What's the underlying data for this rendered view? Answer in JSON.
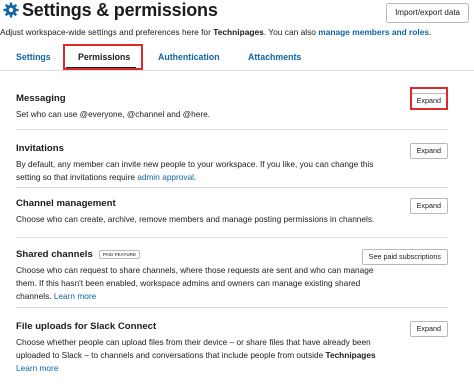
{
  "header": {
    "title": "Settings & permissions",
    "import_export_label": "Import/export data"
  },
  "subtitle": {
    "text_before": "Adjust workspace-wide settings and preferences here for ",
    "workspace": "Technipages",
    "text_middle": ". You can also ",
    "link": "manage members and roles",
    "text_after": "."
  },
  "tabs": [
    {
      "label": "Settings"
    },
    {
      "label": "Permissions"
    },
    {
      "label": "Authentication"
    },
    {
      "label": "Attachments"
    }
  ],
  "active_tab": "Permissions",
  "sections": [
    {
      "title": "Messaging",
      "description": "Set who can use @everyone, @channel and @here.",
      "button": "Expand"
    },
    {
      "title": "Invitations",
      "description": "By default, any member can invite new people to your workspace. If you like, you can change this setting so that invitations require ",
      "link": "admin approval",
      "description_after": ".",
      "button": "Expand"
    },
    {
      "title": "Channel management",
      "description": "Choose who can create, archive, remove members and manage posting permissions in channels.",
      "button": "Expand"
    },
    {
      "title": "Shared channels",
      "badge": "PAID FEATURE",
      "description": "Choose who can request to share channels, where those requests are sent and who can manage them. If this hasn't been enabled, workspace admins and owners can manage existing shared channels. ",
      "link": "Learn more",
      "button": "See paid subscriptions"
    },
    {
      "title": "File uploads for Slack Connect",
      "description": "Choose whether people can upload files from their device – or share files that have already been uploaded to Slack – to channels and conversations that include people from outside ",
      "workspace": "Technipages",
      "link": "Learn more",
      "button": "Expand"
    }
  ],
  "colors": {
    "link": "#1264a3",
    "highlight": "#d92b2b",
    "text": "#1d1c1d",
    "gear_icon": "#1264a3"
  }
}
